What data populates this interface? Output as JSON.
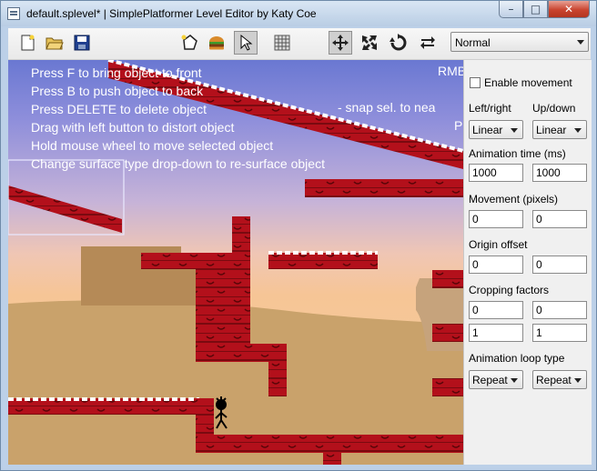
{
  "window": {
    "title": "default.splevel* | SimplePlatformer Level Editor by Katy Coe",
    "minimize_glyph": "–",
    "maximize_glyph": "□",
    "close_glyph": "✕"
  },
  "toolbar": {
    "buttons": [
      {
        "name": "new-file-icon"
      },
      {
        "name": "open-folder-icon"
      },
      {
        "name": "save-icon"
      },
      {
        "name": "polygon-icon"
      },
      {
        "name": "burger-icon"
      },
      {
        "name": "pointer-icon",
        "active": true
      },
      {
        "name": "grid-icon"
      },
      {
        "name": "move-icon",
        "active": true
      },
      {
        "name": "scale-icon"
      },
      {
        "name": "rotate-icon"
      },
      {
        "name": "flip-icon"
      }
    ],
    "surface_dropdown": {
      "value": "Normal"
    }
  },
  "canvas": {
    "help_lines": [
      "Press F to bring object to front",
      "Press B to push object to back",
      "Press DELETE to delete object",
      "Drag with left button to distort object",
      "Hold mouse wheel to move selected object",
      "Change surface type drop-down to re-surface object"
    ],
    "help_right_1": "RMB",
    "help_right_2": "- snap sel. to nea",
    "help_right_3": "P"
  },
  "panel": {
    "enable_movement_label": "Enable movement",
    "enable_movement_checked": false,
    "leftright_label": "Left/right",
    "updown_label": "Up/down",
    "leftright_value": "Linear",
    "updown_value": "Linear",
    "anim_time_label": "Animation time (ms)",
    "anim_time_x": "1000",
    "anim_time_y": "1000",
    "movement_label": "Movement (pixels)",
    "movement_x": "0",
    "movement_y": "0",
    "origin_label": "Origin offset",
    "origin_x": "0",
    "origin_y": "0",
    "cropping_label": "Cropping factors",
    "crop_1": "0",
    "crop_2": "0",
    "crop_3": "1",
    "crop_4": "1",
    "loop_label": "Animation loop type",
    "loop_x": "Repeat",
    "loop_y": "Repeat"
  },
  "colors": {
    "platform_red": "#b3101b",
    "platform_dark": "#7a0a10",
    "snow": "#ffffff",
    "ground": "#c9a26b",
    "sky_top": "#6a78d2"
  }
}
